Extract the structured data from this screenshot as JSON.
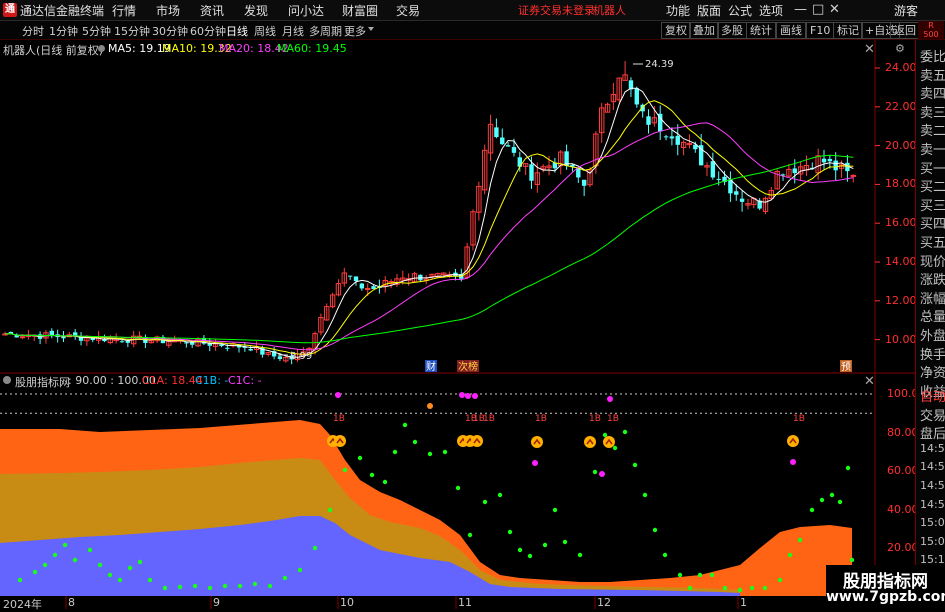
{
  "titlebar": {
    "app_title": "通达信金融终端",
    "menus": [
      "行情",
      "市场",
      "资讯",
      "发现",
      "问小达",
      "财富圈",
      "交易"
    ],
    "warning": "证券交易未登录",
    "stock_name_top": "机器人",
    "right_menus": [
      "功能",
      "版面",
      "公式",
      "选项"
    ],
    "guest": "游客",
    "win_min": "—",
    "win_max": "□",
    "win_close": "✕"
  },
  "toolbar": {
    "periods": [
      "分时",
      "1分钟",
      "5分钟",
      "15分钟",
      "30分钟",
      "60分钟",
      "日线",
      "周线",
      "月线",
      "多周期",
      "更多"
    ],
    "active_period": "日线",
    "tools": [
      "复权",
      "叠加",
      "多股",
      "统计",
      "画线",
      "F10",
      "标记",
      "+自选",
      "返回"
    ],
    "rbadge_top": "R",
    "rbadge_bottom": "500"
  },
  "main_info": {
    "title": "机器人(日线 前复权)",
    "ma5": "MA5: 19.19",
    "ma10": "MA10: 19.32",
    "ma20": "MA20: 18.42",
    "ma60": "MA60: 19.45",
    "high_label": "24.39",
    "low_label": "8.99",
    "ma5_color": "#ffffff",
    "ma10_color": "#ffff00",
    "ma20_color": "#ff40ff",
    "ma60_color": "#00ff00"
  },
  "price_axis": [
    "24.00",
    "22.00",
    "20.00",
    "18.00",
    "16.00",
    "14.00",
    "12.00",
    "10.00"
  ],
  "markers": {
    "cai": "财",
    "ciban": "次榜",
    "yu": "预"
  },
  "indicator": {
    "title": "股朋指标网",
    "params": ": 90.00 : 100.00",
    "c1a": "C1A: 18.44",
    "c1b": "C1B: -",
    "c1c": "C1C: -",
    "axis": [
      "100.00",
      "80.00",
      "60.00",
      "40.00",
      "20.00"
    ],
    "signal_labels": [
      "1B",
      "1B",
      "1B",
      "1B",
      "1B",
      "1B",
      "1B",
      "1B"
    ]
  },
  "date_axis": [
    "2024年",
    "8",
    "9",
    "10",
    "11",
    "12",
    "1"
  ],
  "sidebar": [
    "委比",
    "卖五",
    "卖四",
    "卖三",
    "卖二",
    "卖一",
    "买一",
    "买二",
    "买三",
    "买四",
    "买五",
    "现价",
    "涨跌",
    "涨幅",
    "总量",
    "外盘",
    "换手",
    "净资",
    "收益",
    "自动",
    "交易",
    "盘后",
    "14:56",
    "14:56",
    "14:56",
    "14:56",
    "15:00",
    "15:01",
    "15:11"
  ],
  "watermark": {
    "line1": "股朋指标网",
    "line2": "www.7gpzb.com"
  }
}
